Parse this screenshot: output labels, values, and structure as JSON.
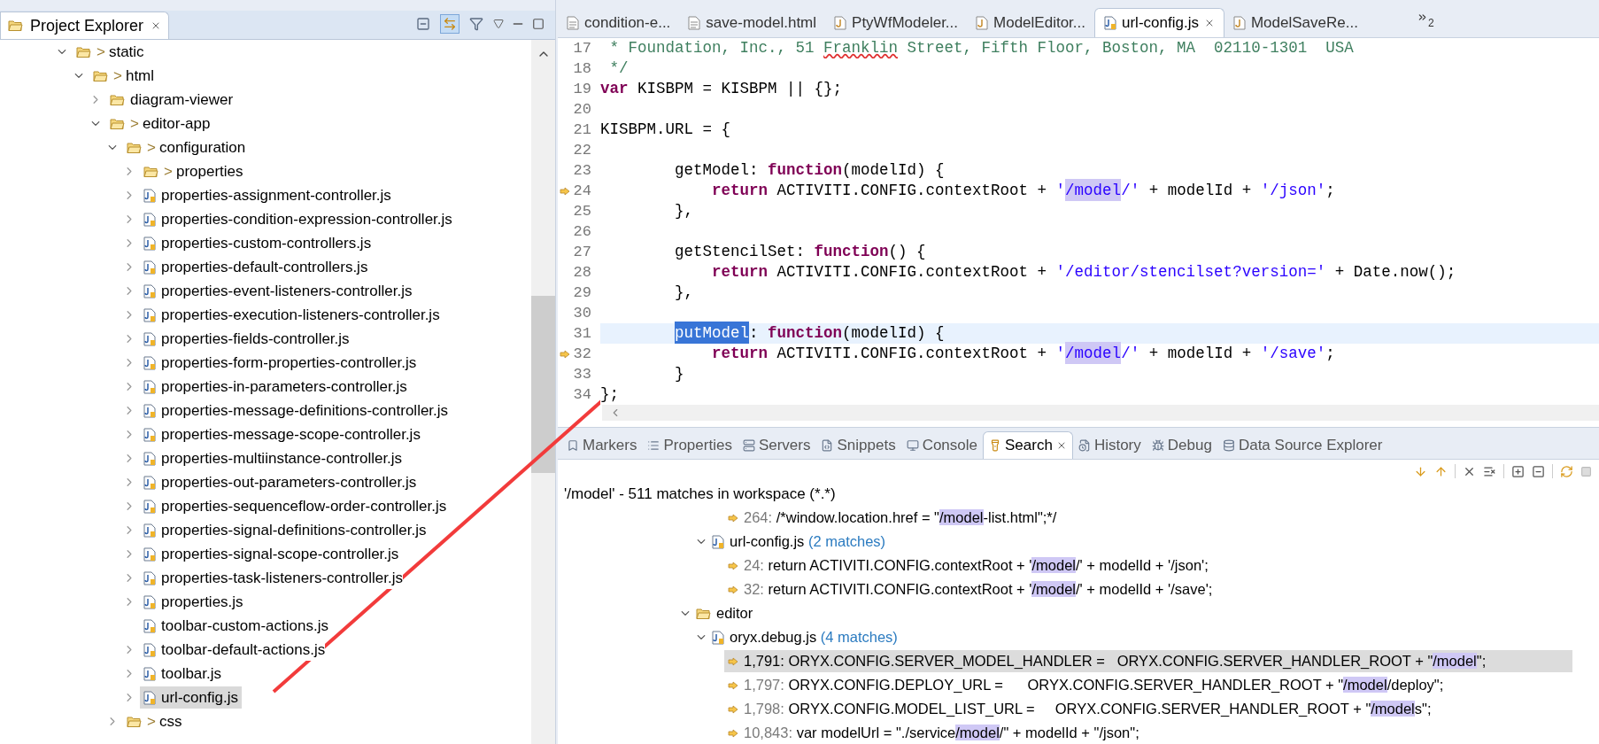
{
  "explorer": {
    "title": "Project Explorer",
    "toolbar": [
      {
        "kind": "collapse",
        "on": false
      },
      {
        "kind": "link",
        "on": true
      },
      {
        "kind": "filter",
        "on": false
      }
    ],
    "tree": [
      {
        "label": "static",
        "kind": "folder",
        "decoration": ">",
        "expanded": true,
        "selected": false,
        "children": [
          {
            "label": "html",
            "kind": "folder",
            "decoration": ">",
            "expanded": true,
            "selected": false,
            "children": [
              {
                "label": "diagram-viewer",
                "kind": "folder",
                "expanded": false,
                "selected": false
              },
              {
                "label": "editor-app",
                "kind": "folder",
                "decoration": ">",
                "expanded": true,
                "selected": false,
                "children": [
                  {
                    "label": "configuration",
                    "kind": "folder",
                    "decoration": ">",
                    "expanded": true,
                    "selected": false,
                    "children": [
                      {
                        "label": "properties",
                        "kind": "folder",
                        "decoration": ">",
                        "expanded": false,
                        "selected": false
                      },
                      {
                        "label": "properties-assignment-controller.js",
                        "kind": "file",
                        "expanded": false,
                        "selected": false
                      },
                      {
                        "label": "properties-condition-expression-controller.js",
                        "kind": "file",
                        "expanded": false,
                        "selected": false
                      },
                      {
                        "label": "properties-custom-controllers.js",
                        "kind": "file",
                        "expanded": false,
                        "selected": false
                      },
                      {
                        "label": "properties-default-controllers.js",
                        "kind": "file",
                        "expanded": false,
                        "selected": false
                      },
                      {
                        "label": "properties-event-listeners-controller.js",
                        "kind": "file",
                        "expanded": false,
                        "selected": false
                      },
                      {
                        "label": "properties-execution-listeners-controller.js",
                        "kind": "file",
                        "expanded": false,
                        "selected": false
                      },
                      {
                        "label": "properties-fields-controller.js",
                        "kind": "file",
                        "expanded": false,
                        "selected": false
                      },
                      {
                        "label": "properties-form-properties-controller.js",
                        "kind": "file",
                        "expanded": false,
                        "selected": false
                      },
                      {
                        "label": "properties-in-parameters-controller.js",
                        "kind": "file",
                        "expanded": false,
                        "selected": false
                      },
                      {
                        "label": "properties-message-definitions-controller.js",
                        "kind": "file",
                        "expanded": false,
                        "selected": false
                      },
                      {
                        "label": "properties-message-scope-controller.js",
                        "kind": "file",
                        "expanded": false,
                        "selected": false
                      },
                      {
                        "label": "properties-multiinstance-controller.js",
                        "kind": "file",
                        "expanded": false,
                        "selected": false
                      },
                      {
                        "label": "properties-out-parameters-controller.js",
                        "kind": "file",
                        "expanded": false,
                        "selected": false
                      },
                      {
                        "label": "properties-sequenceflow-order-controller.js",
                        "kind": "file",
                        "expanded": false,
                        "selected": false
                      },
                      {
                        "label": "properties-signal-definitions-controller.js",
                        "kind": "file",
                        "expanded": false,
                        "selected": false
                      },
                      {
                        "label": "properties-signal-scope-controller.js",
                        "kind": "file",
                        "expanded": false,
                        "selected": false
                      },
                      {
                        "label": "properties-task-listeners-controller.js",
                        "kind": "file",
                        "expanded": false,
                        "selected": false
                      },
                      {
                        "label": "properties.js",
                        "kind": "file",
                        "expanded": false,
                        "selected": false
                      },
                      {
                        "label": "toolbar-custom-actions.js",
                        "kind": "file",
                        "selected": false
                      },
                      {
                        "label": "toolbar-default-actions.js",
                        "kind": "file",
                        "expanded": false,
                        "selected": false
                      },
                      {
                        "label": "toolbar.js",
                        "kind": "file",
                        "expanded": false,
                        "selected": false
                      },
                      {
                        "label": "url-config.js",
                        "kind": "file",
                        "expanded": false,
                        "selected": true
                      }
                    ]
                  },
                  {
                    "label": "css",
                    "kind": "folder",
                    "decoration": ">",
                    "expanded": false,
                    "selected": false
                  }
                ]
              }
            ]
          }
        ]
      }
    ]
  },
  "editor": {
    "tabs": [
      {
        "label": "condition-e...",
        "kind": "text",
        "selected": false
      },
      {
        "label": "save-model.html",
        "kind": "text",
        "selected": false
      },
      {
        "label": "PtyWfModeler...",
        "kind": "java",
        "selected": false
      },
      {
        "label": "ModelEditor...",
        "kind": "java",
        "selected": false
      },
      {
        "label": "url-config.js",
        "kind": "js",
        "selected": true
      },
      {
        "label": "ModelSaveRe...",
        "kind": "java",
        "selected": false
      }
    ],
    "overflow_count": "2",
    "lines": [
      {
        "n": "17",
        "marker": false,
        "current": false,
        "tokens": [
          {
            "kind": "comment",
            "text": " * Foundation, Inc., 51 "
          },
          {
            "kind": "comment_spell",
            "text": "Franklin"
          },
          {
            "kind": "comment",
            "text": " Street, Fifth Floor, Boston, MA  02110-1301  USA"
          }
        ]
      },
      {
        "n": "18",
        "marker": false,
        "current": false,
        "tokens": [
          {
            "kind": "comment",
            "text": " */"
          }
        ]
      },
      {
        "n": "19",
        "marker": false,
        "current": false,
        "tokens": [
          {
            "kind": "keyword",
            "text": "var"
          },
          {
            "kind": "text",
            "text": " KISBPM = KISBPM || {};"
          }
        ]
      },
      {
        "n": "20",
        "marker": false,
        "current": false
      },
      {
        "n": "21",
        "marker": false,
        "current": false,
        "tokens": [
          {
            "kind": "text",
            "text": "KISBPM.URL = {"
          }
        ]
      },
      {
        "n": "22",
        "marker": false,
        "current": false
      },
      {
        "n": "23",
        "marker": false,
        "current": false,
        "tokens": [
          {
            "kind": "text",
            "text": "        getModel: "
          },
          {
            "kind": "keyword",
            "text": "function"
          },
          {
            "kind": "text",
            "text": "(modelId) {"
          }
        ]
      },
      {
        "n": "24",
        "marker": true,
        "current": false,
        "tokens": [
          {
            "kind": "keyword",
            "text": "            return"
          },
          {
            "kind": "text",
            "text": " ACTIVITI.CONFIG.contextRoot + "
          },
          {
            "kind": "string",
            "text": "'"
          },
          {
            "kind": "match",
            "text": "/model"
          },
          {
            "kind": "string",
            "text": "/'"
          },
          {
            "kind": "text",
            "text": " + modelId + "
          },
          {
            "kind": "string",
            "text": "'/json'"
          },
          {
            "kind": "text",
            "text": ";"
          }
        ]
      },
      {
        "n": "25",
        "marker": false,
        "current": false,
        "tokens": [
          {
            "kind": "text",
            "text": "        },"
          }
        ]
      },
      {
        "n": "26",
        "marker": false,
        "current": false
      },
      {
        "n": "27",
        "marker": false,
        "current": false,
        "tokens": [
          {
            "kind": "text",
            "text": "        getStencilSet: "
          },
          {
            "kind": "keyword",
            "text": "function"
          },
          {
            "kind": "text",
            "text": "() {"
          }
        ]
      },
      {
        "n": "28",
        "marker": false,
        "current": false,
        "tokens": [
          {
            "kind": "keyword",
            "text": "            return"
          },
          {
            "kind": "text",
            "text": " ACTIVITI.CONFIG.contextRoot + "
          },
          {
            "kind": "string",
            "text": "'/editor/stencilset?version='"
          },
          {
            "kind": "text",
            "text": " + Date.now();"
          }
        ]
      },
      {
        "n": "29",
        "marker": false,
        "current": false,
        "tokens": [
          {
            "kind": "text",
            "text": "        },"
          }
        ]
      },
      {
        "n": "30",
        "marker": false,
        "current": false
      },
      {
        "n": "31",
        "marker": false,
        "current": true,
        "tokens": [
          {
            "kind": "selected",
            "text": "putModel"
          },
          {
            "kind": "text",
            "text": ": "
          },
          {
            "kind": "keyword",
            "text": "function"
          },
          {
            "kind": "text",
            "text": "(modelId) {"
          }
        ],
        "indented": true
      },
      {
        "n": "32",
        "marker": true,
        "current": false,
        "tokens": [
          {
            "kind": "keyword",
            "text": "            return"
          },
          {
            "kind": "text",
            "text": " ACTIVITI.CONFIG.contextRoot + "
          },
          {
            "kind": "string",
            "text": "'"
          },
          {
            "kind": "match",
            "text": "/model"
          },
          {
            "kind": "string",
            "text": "/'"
          },
          {
            "kind": "text",
            "text": " + modelId + "
          },
          {
            "kind": "string",
            "text": "'/save'"
          },
          {
            "kind": "text",
            "text": ";"
          }
        ]
      },
      {
        "n": "33",
        "marker": false,
        "current": false,
        "tokens": [
          {
            "kind": "text",
            "text": "        }"
          }
        ]
      },
      {
        "n": "34",
        "marker": false,
        "current": false,
        "tokens": [
          {
            "kind": "text",
            "text": "};"
          }
        ]
      }
    ]
  },
  "bottom_panel": {
    "tabs": [
      {
        "label": "Markers",
        "kind": "markers",
        "selected": false
      },
      {
        "label": "Properties",
        "kind": "properties",
        "selected": false
      },
      {
        "label": "Servers",
        "kind": "servers",
        "selected": false
      },
      {
        "label": "Snippets",
        "kind": "snippets",
        "selected": false
      },
      {
        "label": "Console",
        "kind": "console",
        "selected": false
      },
      {
        "label": "Search",
        "kind": "search",
        "selected": true
      },
      {
        "label": "History",
        "kind": "history",
        "selected": false
      },
      {
        "label": "Debug",
        "kind": "debug",
        "selected": false
      },
      {
        "label": "Data Source Explorer",
        "kind": "datasource",
        "selected": false
      }
    ],
    "search": {
      "summary": "'/model' - 511 matches in workspace (*.*)",
      "results": [
        {
          "kind": "match",
          "line": "264:",
          "selected": false,
          "tokens": [
            {
              "kind": "text",
              "text": "/*window.location.href = \""
            },
            {
              "kind": "match",
              "text": "/model"
            },
            {
              "kind": "text",
              "text": "-list.html\";*/"
            }
          ]
        },
        {
          "kind": "file",
          "label": "url-config.js",
          "count": "(2 matches)",
          "expanded": true,
          "children": [
            {
              "kind": "match",
              "line": "24:",
              "selected": false,
              "tokens": [
                {
                  "kind": "text",
                  "text": "return ACTIVITI.CONFIG.contextRoot + '"
                },
                {
                  "kind": "match",
                  "text": "/model"
                },
                {
                  "kind": "text",
                  "text": "/' + modelId + '/json';"
                }
              ]
            },
            {
              "kind": "match",
              "line": "32:",
              "selected": false,
              "tokens": [
                {
                  "kind": "text",
                  "text": "return ACTIVITI.CONFIG.contextRoot + '"
                },
                {
                  "kind": "match",
                  "text": "/model"
                },
                {
                  "kind": "text",
                  "text": "/' + modelId + '/save';"
                }
              ]
            }
          ]
        },
        {
          "kind": "folder",
          "label": "editor",
          "expanded": true,
          "children": [
            {
              "kind": "file",
              "label": "oryx.debug.js",
              "count": "(4 matches)",
              "expanded": true,
              "children": [
                {
                  "kind": "match",
                  "line": "1,791:",
                  "selected": true,
                  "tokens": [
                    {
                      "kind": "text",
                      "text": "ORYX.CONFIG.SERVER_MODEL_HANDLER =   ORYX.CONFIG.SERVER_HANDLER_ROOT + \""
                    },
                    {
                      "kind": "match",
                      "text": "/model"
                    },
                    {
                      "kind": "text",
                      "text": "\";"
                    }
                  ]
                },
                {
                  "kind": "match",
                  "line": "1,797:",
                  "selected": false,
                  "tokens": [
                    {
                      "kind": "text",
                      "text": "ORYX.CONFIG.DEPLOY_URL =      ORYX.CONFIG.SERVER_HANDLER_ROOT + \""
                    },
                    {
                      "kind": "match",
                      "text": "/model"
                    },
                    {
                      "kind": "text",
                      "text": "/deploy\";"
                    }
                  ]
                },
                {
                  "kind": "match",
                  "line": "1,798:",
                  "selected": false,
                  "tokens": [
                    {
                      "kind": "text",
                      "text": "ORYX.CONFIG.MODEL_LIST_URL =     ORYX.CONFIG.SERVER_HANDLER_ROOT + \""
                    },
                    {
                      "kind": "match",
                      "text": "/model"
                    },
                    {
                      "kind": "text",
                      "text": "s\";"
                    }
                  ]
                },
                {
                  "kind": "match",
                  "line": "10,843:",
                  "selected": false,
                  "tokens": [
                    {
                      "kind": "text",
                      "text": "var modelUrl = \"./service"
                    },
                    {
                      "kind": "match",
                      "text": "/model"
                    },
                    {
                      "kind": "text",
                      "text": "/\" + modelId + \"/json\";"
                    }
                  ]
                }
              ]
            }
          ]
        }
      ]
    }
  }
}
